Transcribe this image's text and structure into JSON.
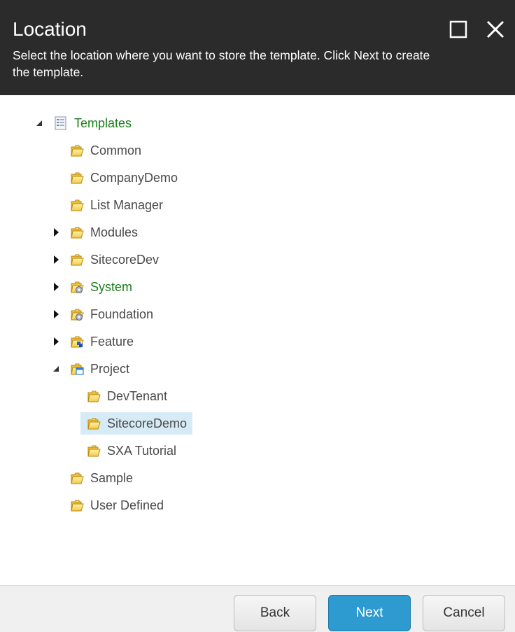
{
  "dialog": {
    "title": "Location",
    "subtitle": "Select the location where you want to store the template. Click Next to create the template."
  },
  "window_controls": {
    "maximize_icon": "maximize-icon",
    "close_icon": "close-icon"
  },
  "tree": {
    "root": {
      "label": "Templates",
      "icon": "template-icon",
      "expanded": true
    },
    "items": [
      {
        "label": "Common",
        "icon": "folder-icon"
      },
      {
        "label": "CompanyDemo",
        "icon": "folder-icon"
      },
      {
        "label": "List Manager",
        "icon": "folder-icon"
      },
      {
        "label": "Modules",
        "icon": "folder-icon",
        "collapsed": true
      },
      {
        "label": "SitecoreDev",
        "icon": "folder-icon",
        "collapsed": true
      },
      {
        "label": "System",
        "icon": "folder-gear-icon",
        "collapsed": true
      },
      {
        "label": "Foundation",
        "icon": "folder-gear-icon",
        "collapsed": true
      },
      {
        "label": "Feature",
        "icon": "folder-feature-icon",
        "collapsed": true
      },
      {
        "label": "Project",
        "icon": "folder-window-icon",
        "expanded": true
      },
      {
        "label": "DevTenant",
        "icon": "folder-icon"
      },
      {
        "label": "SitecoreDemo",
        "icon": "folder-icon",
        "selected": true
      },
      {
        "label": "SXA Tutorial",
        "icon": "folder-icon"
      },
      {
        "label": "Sample",
        "icon": "folder-icon"
      },
      {
        "label": "User Defined",
        "icon": "folder-icon"
      }
    ]
  },
  "footer": {
    "back_label": "Back",
    "next_label": "Next",
    "cancel_label": "Cancel"
  },
  "colors": {
    "header_bg": "#2b2b2b",
    "selection_bg": "#d6ebf5",
    "green_label": "#1a7f1a",
    "primary_button": "#2e9bd0"
  }
}
